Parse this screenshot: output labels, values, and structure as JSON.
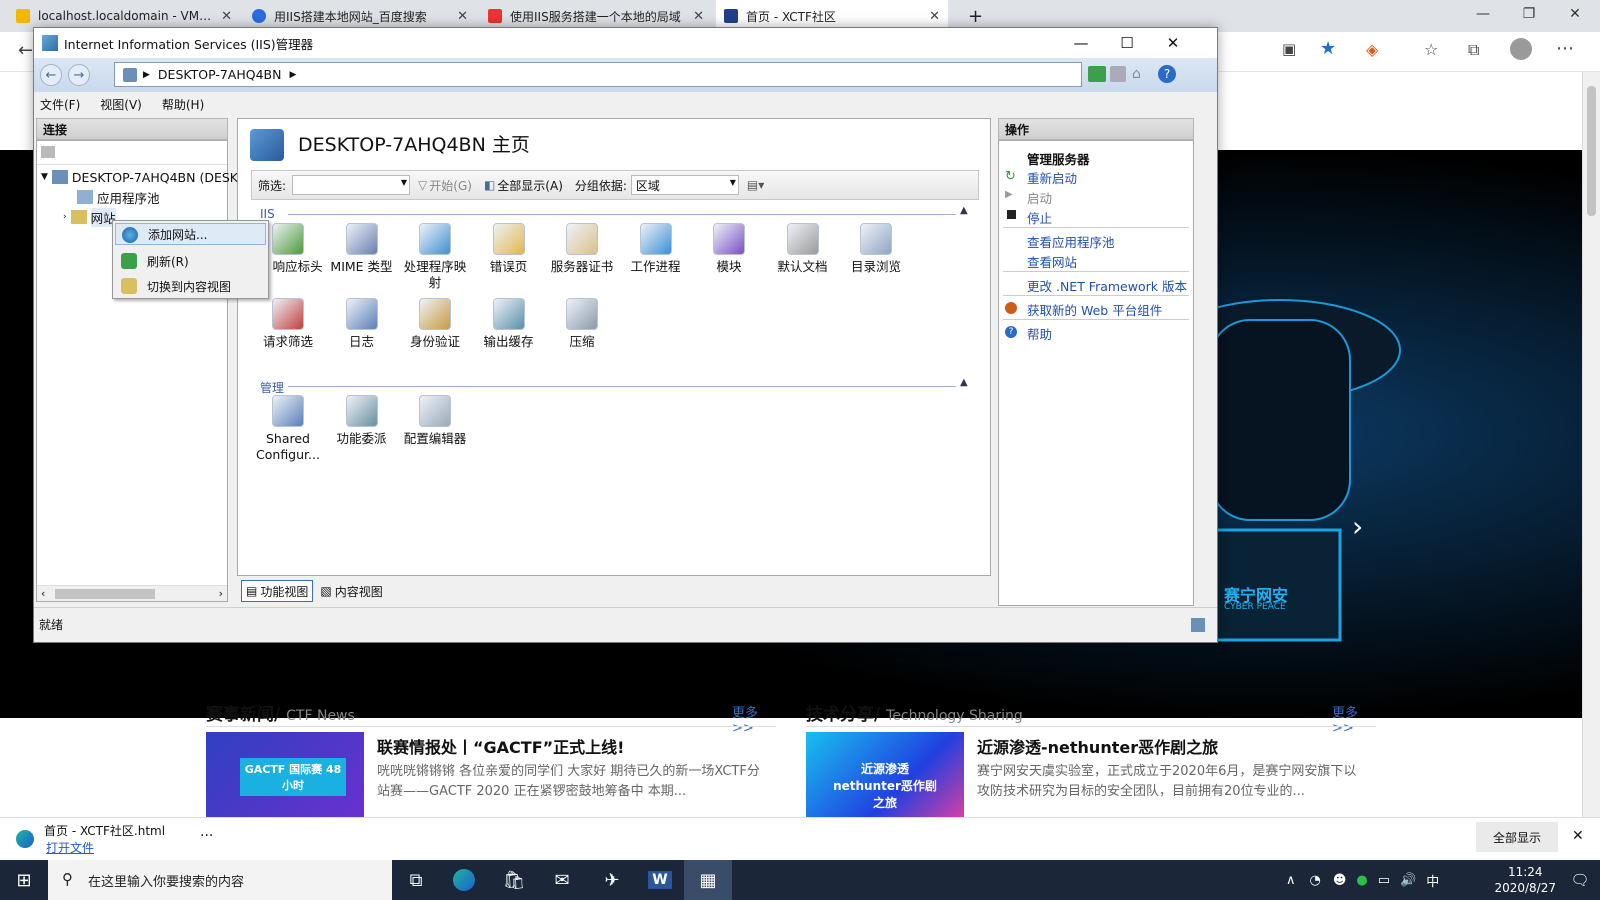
{
  "browser": {
    "tabs": [
      {
        "title": "localhost.localdomain - VMware"
      },
      {
        "title": "用IIS搭建本地网站_百度搜索"
      },
      {
        "title": "使用IIS服务搭建一个本地的局域"
      },
      {
        "title": "首页 - XCTF社区"
      }
    ],
    "colors": {
      "tabstrip": "#dfe3e8",
      "active_tab": "#ffffff"
    }
  },
  "webpage": {
    "sections": [
      {
        "heading": "赛事新闻/",
        "sub": "CTF News",
        "more": "更多>>",
        "item_title": "联赛情报处丨“GACTF”正式上线!",
        "item_desc": "咣咣咣锵锵锵 各位亲爱的同学们 大家好 期待已久的新一场XCTF分站赛——GACTF 2020 正在紧锣密鼓地筹备中 本期...",
        "thumb_caption": "GACTF 国际赛 48小时"
      },
      {
        "heading": "技术分享/",
        "sub": "Technology Sharing",
        "more": "更多>>",
        "item_title": "近源渗透-nethunter恶作剧之旅",
        "item_desc": "赛宁网安天虞实验室，正式成立于2020年6月，是赛宁网安旗下以攻防技术研究为目标的安全团队，目前拥有20位专业的...",
        "thumb_caption": "近源渗透 nethunter恶作剧之旅"
      }
    ],
    "hero": {
      "brand": "赛宁网安",
      "brand_sub": "CYBER PEACE"
    }
  },
  "download_bar": {
    "filename": "首页 - XCTF社区.html",
    "open": "打开文件",
    "more": "···",
    "show_all": "全部显示"
  },
  "taskbar": {
    "search_placeholder": "在这里输入你要搜索的内容",
    "time": "11:24",
    "date": "2020/8/27",
    "ime": "中"
  },
  "iis": {
    "title": "Internet Information Services (IIS)管理器",
    "address": "DESKTOP-7AHQ4BN",
    "menu": [
      "文件(F)",
      "视图(V)",
      "帮助(H)"
    ],
    "connections": {
      "header": "连接",
      "server": "DESKTOP-7AHQ4BN (DESK",
      "app_pools": "应用程序池",
      "sites": "网站"
    },
    "context_menu": [
      "添加网站...",
      "刷新(R)",
      "切换到内容视图"
    ],
    "center": {
      "title": "DESKTOP-7AHQ4BN 主页",
      "filter_label": "筛选:",
      "start": "开始(G)",
      "show_all": "全部显示(A)",
      "group_by_label": "分组依据:",
      "group_by_value": "区域",
      "groups": [
        {
          "name": "IIS",
          "features": [
            {
              "label": "TP 响应标头",
              "icon": "http-response-icon",
              "color": "#4e9a3a"
            },
            {
              "label": "MIME 类型",
              "icon": "mime-icon",
              "color": "#6a7fb0"
            },
            {
              "label": "处理程序映射",
              "icon": "handler-icon",
              "color": "#3f8fcf"
            },
            {
              "label": "错误页",
              "icon": "error-page-icon",
              "color": "#e0b84a"
            },
            {
              "label": "服务器证书",
              "icon": "certificate-icon",
              "color": "#d9c08c"
            },
            {
              "label": "工作进程",
              "icon": "worker-process-icon",
              "color": "#3a8fd6"
            },
            {
              "label": "模块",
              "icon": "modules-icon",
              "color": "#7a4fc4"
            },
            {
              "label": "默认文档",
              "icon": "default-doc-icon",
              "color": "#9a9a9a"
            },
            {
              "label": "目录浏览",
              "icon": "dir-browse-icon",
              "color": "#8fa6c4"
            },
            {
              "label": "请求筛选",
              "icon": "request-filter-icon",
              "color": "#c04040"
            },
            {
              "label": "日志",
              "icon": "logging-icon",
              "color": "#5a7fb8"
            },
            {
              "label": "身份验证",
              "icon": "auth-icon",
              "color": "#c89a40"
            },
            {
              "label": "输出缓存",
              "icon": "output-cache-icon",
              "color": "#5a8fa8"
            },
            {
              "label": "压缩",
              "icon": "compression-icon",
              "color": "#8a9aa8"
            }
          ]
        },
        {
          "name": "管理",
          "features": [
            {
              "label": "Shared Configur...",
              "icon": "shared-config-icon",
              "color": "#5a7fb8"
            },
            {
              "label": "功能委派",
              "icon": "delegation-icon",
              "color": "#6a8fa0"
            },
            {
              "label": "配置编辑器",
              "icon": "config-editor-icon",
              "color": "#9aa8b8"
            }
          ]
        }
      ]
    },
    "view_tabs": [
      "功能视图",
      "内容视图"
    ],
    "actions": {
      "header": "操作",
      "manage_server": "管理服务器",
      "restart": "重新启动",
      "start": "启动",
      "stop": "停止",
      "view_app_pools": "查看应用程序池",
      "view_sites": "查看网站",
      "change_net": "更改 .NET Framework 版本",
      "get_web_platform": "获取新的 Web 平台组件",
      "help": "帮助"
    },
    "status": "就绪"
  }
}
